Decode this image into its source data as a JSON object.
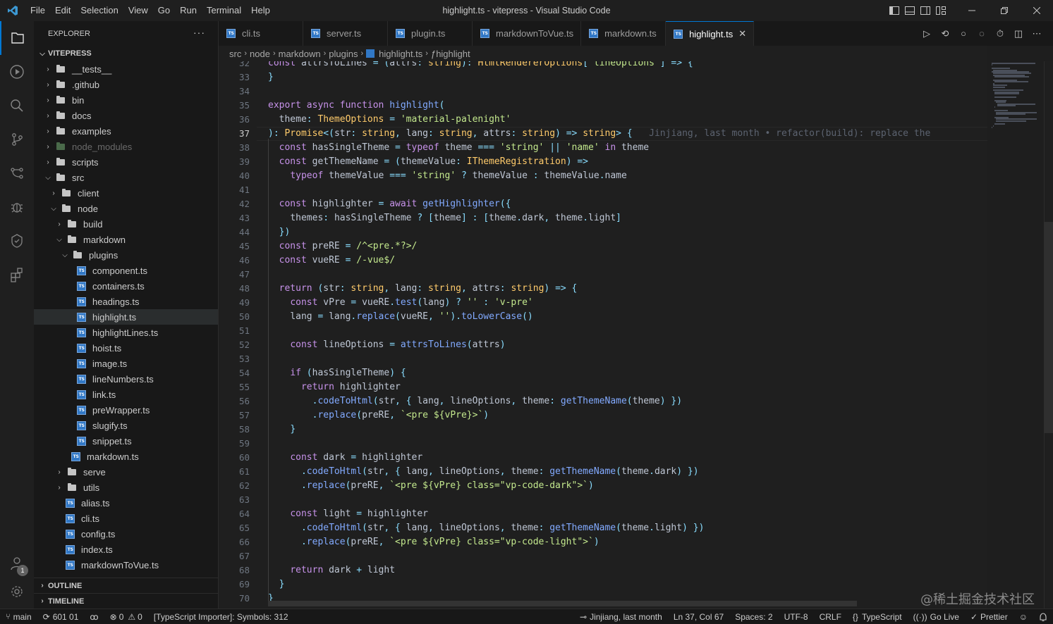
{
  "titlebar": {
    "menu": [
      "File",
      "Edit",
      "Selection",
      "View",
      "Go",
      "Run",
      "Terminal",
      "Help"
    ],
    "window_title": "highlight.ts - vitepress - Visual Studio Code",
    "window_controls": [
      "minimize-icon",
      "restore-icon",
      "close-icon"
    ]
  },
  "activity_bar": {
    "icons": [
      "explorer-icon",
      "run-debug-icon",
      "search-icon",
      "source-control-icon",
      "git-graph-icon",
      "debug-icon",
      "testing-icon",
      "extensions-icon"
    ],
    "bottom_icons": [
      "accounts-icon",
      "manage-icon"
    ],
    "accounts_badge": "1"
  },
  "sidebar": {
    "header": "EXPLORER",
    "more": "···",
    "root": "VITEPRESS",
    "tree": [
      {
        "label": "__tests__",
        "type": "folder",
        "depth": 1,
        "state": "collapsed"
      },
      {
        "label": ".github",
        "type": "folder",
        "depth": 1,
        "state": "collapsed"
      },
      {
        "label": "bin",
        "type": "folder",
        "depth": 1,
        "state": "collapsed"
      },
      {
        "label": "docs",
        "type": "folder",
        "depth": 1,
        "state": "collapsed"
      },
      {
        "label": "examples",
        "type": "folder",
        "depth": 1,
        "state": "collapsed"
      },
      {
        "label": "node_modules",
        "type": "folder",
        "depth": 1,
        "state": "collapsed",
        "dim": true
      },
      {
        "label": "scripts",
        "type": "folder",
        "depth": 1,
        "state": "collapsed"
      },
      {
        "label": "src",
        "type": "folder",
        "depth": 1,
        "state": "expanded"
      },
      {
        "label": "client",
        "type": "folder",
        "depth": 2,
        "state": "collapsed"
      },
      {
        "label": "node",
        "type": "folder",
        "depth": 2,
        "state": "expanded"
      },
      {
        "label": "build",
        "type": "folder",
        "depth": 3,
        "state": "collapsed"
      },
      {
        "label": "markdown",
        "type": "folder",
        "depth": 3,
        "state": "expanded"
      },
      {
        "label": "plugins",
        "type": "folder",
        "depth": 4,
        "state": "expanded"
      },
      {
        "label": "component.ts",
        "type": "ts",
        "depth": 5
      },
      {
        "label": "containers.ts",
        "type": "ts",
        "depth": 5
      },
      {
        "label": "headings.ts",
        "type": "ts",
        "depth": 5
      },
      {
        "label": "highlight.ts",
        "type": "ts",
        "depth": 5,
        "selected": true
      },
      {
        "label": "highlightLines.ts",
        "type": "ts",
        "depth": 5
      },
      {
        "label": "hoist.ts",
        "type": "ts",
        "depth": 5
      },
      {
        "label": "image.ts",
        "type": "ts",
        "depth": 5
      },
      {
        "label": "lineNumbers.ts",
        "type": "ts",
        "depth": 5
      },
      {
        "label": "link.ts",
        "type": "ts",
        "depth": 5
      },
      {
        "label": "preWrapper.ts",
        "type": "ts",
        "depth": 5
      },
      {
        "label": "slugify.ts",
        "type": "ts",
        "depth": 5
      },
      {
        "label": "snippet.ts",
        "type": "ts",
        "depth": 5
      },
      {
        "label": "markdown.ts",
        "type": "ts",
        "depth": 4
      },
      {
        "label": "serve",
        "type": "folder",
        "depth": 3,
        "state": "collapsed"
      },
      {
        "label": "utils",
        "type": "folder",
        "depth": 3,
        "state": "collapsed"
      },
      {
        "label": "alias.ts",
        "type": "ts",
        "depth": 3
      },
      {
        "label": "cli.ts",
        "type": "ts",
        "depth": 3
      },
      {
        "label": "config.ts",
        "type": "ts",
        "depth": 3
      },
      {
        "label": "index.ts",
        "type": "ts",
        "depth": 3
      },
      {
        "label": "markdownToVue.ts",
        "type": "ts",
        "depth": 3
      }
    ],
    "outline": "OUTLINE",
    "timeline": "TIMELINE"
  },
  "tabs": [
    {
      "label": "cli.ts",
      "active": false
    },
    {
      "label": "server.ts",
      "active": false
    },
    {
      "label": "plugin.ts",
      "active": false
    },
    {
      "label": "markdownToVue.ts",
      "active": false
    },
    {
      "label": "markdown.ts",
      "active": false
    },
    {
      "label": "highlight.ts",
      "active": true
    }
  ],
  "tab_close": "✕",
  "breadcrumb": [
    "src",
    "node",
    "markdown",
    "plugins",
    "highlight.ts",
    "highlight"
  ],
  "editor": {
    "current_line": 37,
    "blame": "Jinjiang, last month • refactor(build): replace the",
    "lines": [
      {
        "n": "32",
        "text": "const attrsToLines = (attrs: string): HtmlRendererOptions['lineOptions'] => {"
      },
      {
        "n": "33",
        "text": "}"
      },
      {
        "n": "34",
        "text": ""
      },
      {
        "n": "35",
        "text": "export async function highlight("
      },
      {
        "n": "36",
        "text": "  theme: ThemeOptions = 'material-palenight'"
      },
      {
        "n": "37",
        "text": "): Promise<(str: string, lang: string, attrs: string) => string> {"
      },
      {
        "n": "38",
        "text": "  const hasSingleTheme = typeof theme === 'string' || 'name' in theme"
      },
      {
        "n": "39",
        "text": "  const getThemeName = (themeValue: IThemeRegistration) =>"
      },
      {
        "n": "40",
        "text": "    typeof themeValue === 'string' ? themeValue : themeValue.name"
      },
      {
        "n": "41",
        "text": ""
      },
      {
        "n": "42",
        "text": "  const highlighter = await getHighlighter({"
      },
      {
        "n": "43",
        "text": "    themes: hasSingleTheme ? [theme] : [theme.dark, theme.light]"
      },
      {
        "n": "44",
        "text": "  })"
      },
      {
        "n": "45",
        "text": "  const preRE = /^<pre.*?>/"
      },
      {
        "n": "46",
        "text": "  const vueRE = /-vue$/"
      },
      {
        "n": "47",
        "text": ""
      },
      {
        "n": "48",
        "text": "  return (str: string, lang: string, attrs: string) => {"
      },
      {
        "n": "49",
        "text": "    const vPre = vueRE.test(lang) ? '' : 'v-pre'"
      },
      {
        "n": "50",
        "text": "    lang = lang.replace(vueRE, '').toLowerCase()"
      },
      {
        "n": "51",
        "text": ""
      },
      {
        "n": "52",
        "text": "    const lineOptions = attrsToLines(attrs)"
      },
      {
        "n": "53",
        "text": ""
      },
      {
        "n": "54",
        "text": "    if (hasSingleTheme) {"
      },
      {
        "n": "55",
        "text": "      return highlighter"
      },
      {
        "n": "56",
        "text": "        .codeToHtml(str, { lang, lineOptions, theme: getThemeName(theme) })"
      },
      {
        "n": "57",
        "text": "        .replace(preRE, `<pre ${vPre}>`)"
      },
      {
        "n": "58",
        "text": "    }"
      },
      {
        "n": "59",
        "text": ""
      },
      {
        "n": "60",
        "text": "    const dark = highlighter"
      },
      {
        "n": "61",
        "text": "      .codeToHtml(str, { lang, lineOptions, theme: getThemeName(theme.dark) })"
      },
      {
        "n": "62",
        "text": "      .replace(preRE, `<pre ${vPre} class=\"vp-code-dark\">`)"
      },
      {
        "n": "63",
        "text": ""
      },
      {
        "n": "64",
        "text": "    const light = highlighter"
      },
      {
        "n": "65",
        "text": "      .codeToHtml(str, { lang, lineOptions, theme: getThemeName(theme.light) })"
      },
      {
        "n": "66",
        "text": "      .replace(preRE, `<pre ${vPre} class=\"vp-code-light\">`)"
      },
      {
        "n": "67",
        "text": ""
      },
      {
        "n": "68",
        "text": "    return dark + light"
      },
      {
        "n": "69",
        "text": "  }"
      },
      {
        "n": "70",
        "text": "}"
      }
    ]
  },
  "statusbar": {
    "branch": "main",
    "sync": "601 01",
    "errors": "0",
    "warnings": "0",
    "importer": "[TypeScript Importer]: Symbols: 312",
    "blame": "Jinjiang, last month",
    "position": "Ln 37, Col 67",
    "spaces": "Spaces: 2",
    "encoding": "UTF-8",
    "eol": "CRLF",
    "language": "TypeScript",
    "golive": "Go Live",
    "prettier": "Prettier"
  },
  "watermark": "@稀土掘金技术社区",
  "colors": {
    "accent": "#0078d4",
    "ts_icon": "#3178c6",
    "keyword": "#c792ea",
    "function": "#82aaff",
    "string": "#c3e88d",
    "type": "#ffcb6b",
    "operator": "#89ddff"
  }
}
